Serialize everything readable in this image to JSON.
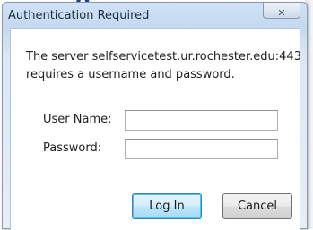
{
  "background": {
    "fragment_text": "g"
  },
  "dialog": {
    "title": "Authentication Required",
    "close_glyph": "✕",
    "message_line1": "The server selfservicetest.ur.rochester.edu:443",
    "message_line2": "requires a username and password.",
    "username_label": "User Name:",
    "username_value": "",
    "password_label": "Password:",
    "password_value": "",
    "login_button": "Log In",
    "cancel_button": "Cancel"
  },
  "colors": {
    "title_bar": "#c4d9f0",
    "default_button_border": "#3c7fb1",
    "background_text": "#1b3f93"
  }
}
